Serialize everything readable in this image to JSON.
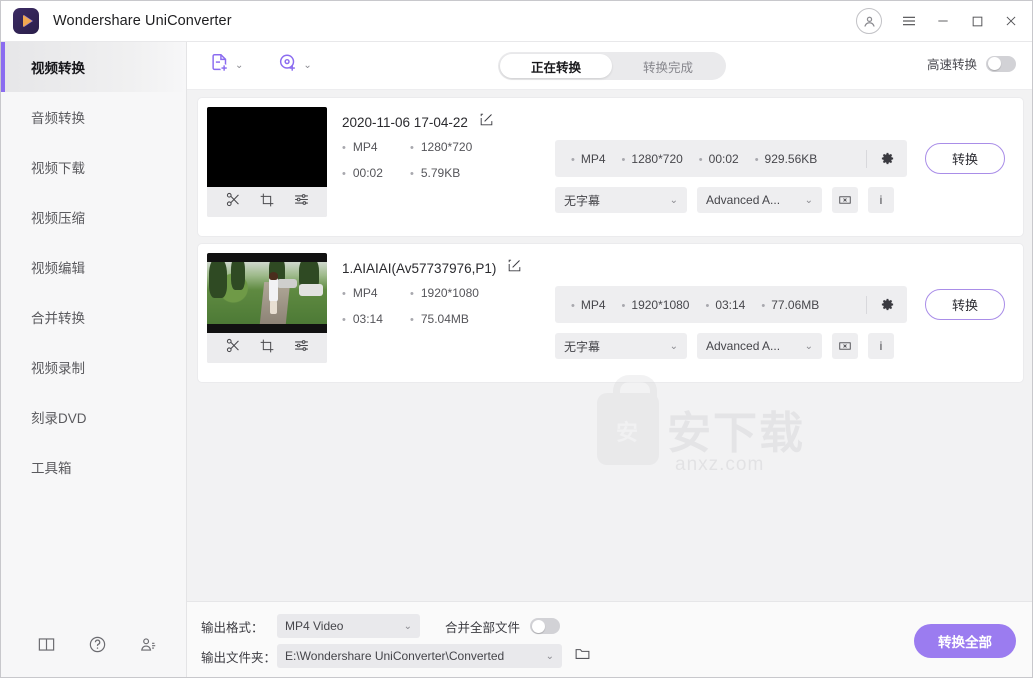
{
  "window": {
    "title": "Wondershare UniConverter",
    "controls": {
      "account": "account-avatar",
      "menu": "☰",
      "minimize": "—",
      "maximize": "□",
      "close": "✕"
    }
  },
  "sidebar": {
    "items": [
      {
        "label": "视频转换",
        "active": true
      },
      {
        "label": "音频转换",
        "active": false
      },
      {
        "label": "视频下载",
        "active": false
      },
      {
        "label": "视频压缩",
        "active": false
      },
      {
        "label": "视频编辑",
        "active": false
      },
      {
        "label": "合并转换",
        "active": false
      },
      {
        "label": "视频录制",
        "active": false
      },
      {
        "label": "刻录DVD",
        "active": false
      },
      {
        "label": "工具箱",
        "active": false
      }
    ],
    "footer_icons": [
      "book-icon",
      "help-icon",
      "users-icon"
    ]
  },
  "toolbar": {
    "add_file_icon": "add-file-icon",
    "add_disc_icon": "add-disc-icon",
    "chevron": "⌄",
    "tabs": [
      {
        "label": "正在转换",
        "active": true
      },
      {
        "label": "转换完成",
        "active": false
      }
    ],
    "high_speed_label": "高速转换",
    "high_speed_on": false
  },
  "files": [
    {
      "name": "2020-11-06 17-04-22",
      "edit_icon": "edit-icon",
      "thumb_type": "black",
      "source": {
        "format": "MP4",
        "resolution": "1280*720",
        "duration": "00:02",
        "size": "5.79KB"
      },
      "output": {
        "format": "MP4",
        "resolution": "1280*720",
        "duration": "00:02",
        "size": "929.56KB"
      },
      "subtitle": "无字幕",
      "audio": "Advanced A...",
      "convert_label": "转换"
    },
    {
      "name": "1.AIAIAI(Av57737976,P1)",
      "edit_icon": "edit-icon",
      "thumb_type": "scene",
      "source": {
        "format": "MP4",
        "resolution": "1920*1080",
        "duration": "03:14",
        "size": "75.04MB"
      },
      "output": {
        "format": "MP4",
        "resolution": "1920*1080",
        "duration": "03:14",
        "size": "77.06MB"
      },
      "subtitle": "无字幕",
      "audio": "Advanced A...",
      "convert_label": "转换"
    }
  ],
  "card_icons": {
    "trim": "scissors-icon",
    "crop": "crop-icon",
    "effect": "sliders-icon",
    "swap": "shuffle-icon",
    "gear": "gear-icon",
    "compress": "compress-icon",
    "info": "i"
  },
  "bottom": {
    "format_label": "输出格式：",
    "format_value": "MP4 Video",
    "merge_label": "合并全部文件",
    "merge_on": false,
    "folder_label": "输出文件夹：",
    "folder_value": "E:\\Wondershare UniConverter\\Converted",
    "folder_icon": "folder-icon",
    "convert_all_label": "转换全部"
  },
  "watermark": {
    "lock_char": "安",
    "text": "安下载",
    "sub": "anxz.com"
  },
  "colors": {
    "accent": "#9b7cf0",
    "accent_border": "#a98de8",
    "sidebar_bg": "#f7f7f8",
    "main_bg": "#f2f2f3"
  }
}
